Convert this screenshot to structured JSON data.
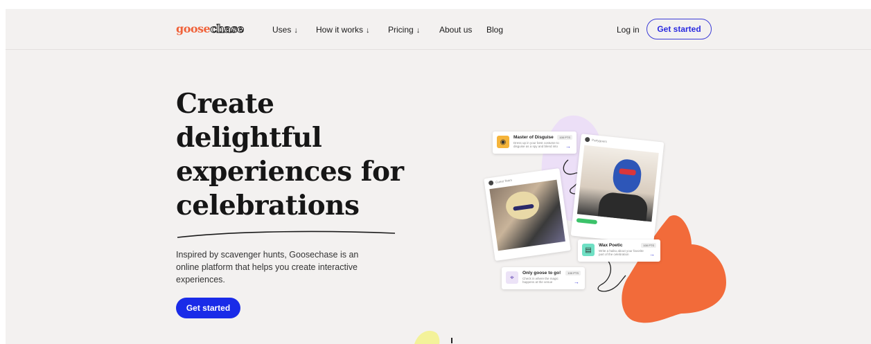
{
  "nav": {
    "logo_part1": "goose",
    "logo_part2": "chase",
    "uses": "Uses",
    "how_it_works": "How it works",
    "pricing": "Pricing",
    "about": "About us",
    "blog": "Blog",
    "login": "Log in",
    "get_started": "Get started",
    "chevron": "↓"
  },
  "hero": {
    "title": "Create delightful experiences for celebrations",
    "description": "Inspired by scavenger hunts, Goosechase is an online platform that helps you create interactive experiences.",
    "cta": "Get started"
  },
  "cards": {
    "mission1_title": "Master of Disguise",
    "mission1_pts": "100 PTS",
    "mission1_desc": "Dress up in your best costume to disguise as a spy and blend into the crowd",
    "mission2_title": "Wax Poetic",
    "mission2_pts": "100 PTS",
    "mission2_desc": "Write a haiku about your favorite part of the celebration",
    "mission3_title": "Only goose to go!",
    "mission3_pts": "100 PTS",
    "mission3_desc": "Check in where the magic happens at the venue",
    "photo1_user": "Guest Team",
    "photo2_user": "Partygoers"
  },
  "colors": {
    "accent_blue": "#1a2be8",
    "orange": "#f26b3a",
    "purple_blob": "#e6d9f5",
    "yellow_blob": "#f3f29a"
  }
}
